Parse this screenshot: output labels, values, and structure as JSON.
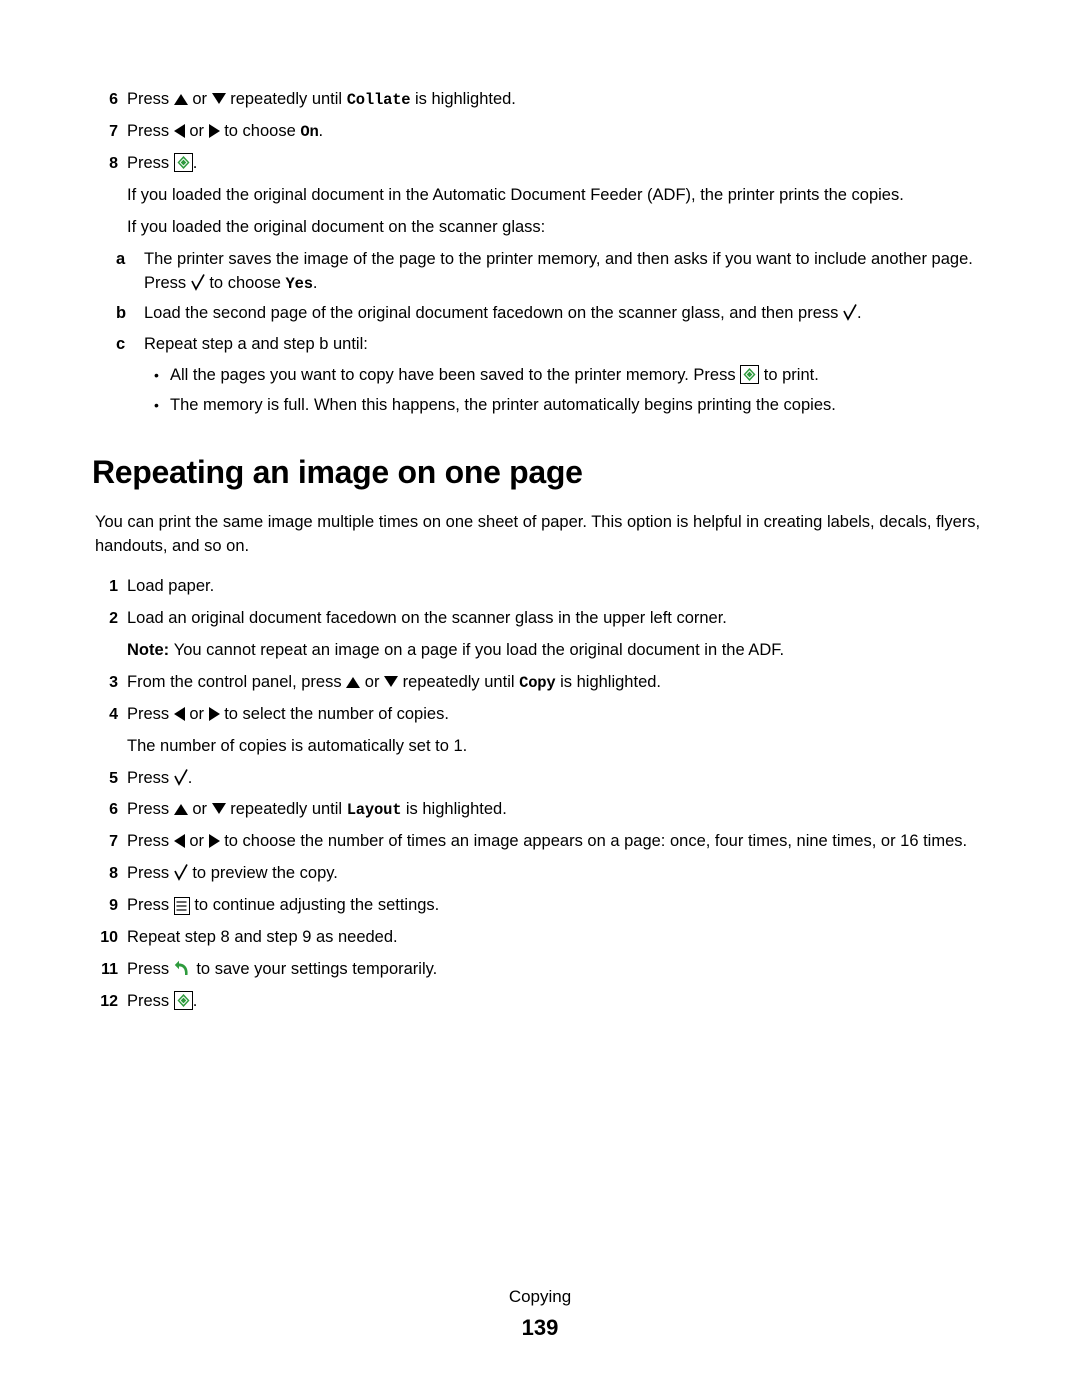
{
  "document": {
    "top_steps": [
      {
        "num": "6",
        "parts": [
          {
            "t": "text",
            "v": "Press "
          },
          {
            "t": "icon",
            "v": "arrow-up-icon"
          },
          {
            "t": "text",
            "v": " or "
          },
          {
            "t": "icon",
            "v": "arrow-down-icon"
          },
          {
            "t": "text",
            "v": " repeatedly until "
          },
          {
            "t": "mono",
            "v": "Collate"
          },
          {
            "t": "text",
            "v": " is highlighted."
          }
        ]
      },
      {
        "num": "7",
        "parts": [
          {
            "t": "text",
            "v": "Press "
          },
          {
            "t": "icon",
            "v": "arrow-left-icon"
          },
          {
            "t": "text",
            "v": " or "
          },
          {
            "t": "icon",
            "v": "arrow-right-icon"
          },
          {
            "t": "text",
            "v": " to choose "
          },
          {
            "t": "mono",
            "v": "On"
          },
          {
            "t": "text",
            "v": "."
          }
        ]
      },
      {
        "num": "8",
        "parts": [
          {
            "t": "text",
            "v": "Press "
          },
          {
            "t": "icon",
            "v": "start-button-icon"
          },
          {
            "t": "text",
            "v": "."
          }
        ]
      }
    ],
    "top_paragraphs": [
      "If you loaded the original document in the Automatic Document Feeder (ADF), the printer prints the copies.",
      "If you loaded the original document on the scanner glass:"
    ],
    "sub_steps": [
      {
        "letter": "a",
        "parts": [
          {
            "t": "text",
            "v": "The printer saves the image of the page to the printer memory, and then asks if you want to include another page. Press "
          },
          {
            "t": "icon",
            "v": "select-check-icon"
          },
          {
            "t": "text",
            "v": " to choose "
          },
          {
            "t": "mono",
            "v": "Yes"
          },
          {
            "t": "text",
            "v": "."
          }
        ]
      },
      {
        "letter": "b",
        "parts": [
          {
            "t": "text",
            "v": "Load the second page of the original document facedown on the scanner glass, and then press "
          },
          {
            "t": "icon",
            "v": "select-check-icon"
          },
          {
            "t": "text",
            "v": "."
          }
        ]
      },
      {
        "letter": "c",
        "parts": [
          {
            "t": "text",
            "v": "Repeat step a and step b until:"
          }
        ]
      }
    ],
    "bullets": [
      {
        "parts": [
          {
            "t": "text",
            "v": "All the pages you want to copy have been saved to the printer memory. Press "
          },
          {
            "t": "icon",
            "v": "start-button-icon"
          },
          {
            "t": "text",
            "v": " to print."
          }
        ]
      },
      {
        "parts": [
          {
            "t": "text",
            "v": "The memory is full. When this happens, the printer automatically begins printing the copies."
          }
        ]
      }
    ],
    "heading": "Repeating an image on one page",
    "intro": "You can print the same image multiple times on one sheet of paper. This option is helpful in creating labels, decals, flyers, handouts, and so on.",
    "main_steps": [
      {
        "num": "1",
        "parts": [
          {
            "t": "text",
            "v": "Load paper."
          }
        ]
      },
      {
        "num": "2",
        "parts": [
          {
            "t": "text",
            "v": "Load an original document facedown on the scanner glass in the upper left corner."
          }
        ]
      },
      {
        "num": "",
        "note": true,
        "parts": [
          {
            "t": "bold",
            "v": "Note: "
          },
          {
            "t": "text",
            "v": "You cannot repeat an image on a page if you load the original document in the ADF."
          }
        ]
      },
      {
        "num": "3",
        "parts": [
          {
            "t": "text",
            "v": "From the control panel, press "
          },
          {
            "t": "icon",
            "v": "arrow-up-icon"
          },
          {
            "t": "text",
            "v": " or "
          },
          {
            "t": "icon",
            "v": "arrow-down-icon"
          },
          {
            "t": "text",
            "v": " repeatedly until "
          },
          {
            "t": "mono",
            "v": "Copy"
          },
          {
            "t": "text",
            "v": " is highlighted."
          }
        ]
      },
      {
        "num": "4",
        "parts": [
          {
            "t": "text",
            "v": "Press "
          },
          {
            "t": "icon",
            "v": "arrow-left-icon"
          },
          {
            "t": "text",
            "v": " or "
          },
          {
            "t": "icon",
            "v": "arrow-right-icon"
          },
          {
            "t": "text",
            "v": " to select the number of copies."
          }
        ]
      },
      {
        "num": "",
        "plain": true,
        "parts": [
          {
            "t": "text",
            "v": "The number of copies is automatically set to 1."
          }
        ]
      },
      {
        "num": "5",
        "parts": [
          {
            "t": "text",
            "v": "Press "
          },
          {
            "t": "icon",
            "v": "select-check-icon"
          },
          {
            "t": "text",
            "v": "."
          }
        ]
      },
      {
        "num": "6",
        "parts": [
          {
            "t": "text",
            "v": "Press "
          },
          {
            "t": "icon",
            "v": "arrow-up-icon"
          },
          {
            "t": "text",
            "v": " or "
          },
          {
            "t": "icon",
            "v": "arrow-down-icon"
          },
          {
            "t": "text",
            "v": " repeatedly until "
          },
          {
            "t": "mono",
            "v": "Layout"
          },
          {
            "t": "text",
            "v": " is highlighted."
          }
        ]
      },
      {
        "num": "7",
        "parts": [
          {
            "t": "text",
            "v": "Press "
          },
          {
            "t": "icon",
            "v": "arrow-left-icon"
          },
          {
            "t": "text",
            "v": " or "
          },
          {
            "t": "icon",
            "v": "arrow-right-icon"
          },
          {
            "t": "text",
            "v": " to choose the number of times an image appears on a page: once, four times, nine times, or 16 times."
          }
        ]
      },
      {
        "num": "8",
        "parts": [
          {
            "t": "text",
            "v": "Press "
          },
          {
            "t": "icon",
            "v": "select-check-icon"
          },
          {
            "t": "text",
            "v": " to preview the copy."
          }
        ]
      },
      {
        "num": "9",
        "parts": [
          {
            "t": "text",
            "v": "Press "
          },
          {
            "t": "icon",
            "v": "menu-button-icon"
          },
          {
            "t": "text",
            "v": " to continue adjusting the settings."
          }
        ]
      },
      {
        "num": "10",
        "parts": [
          {
            "t": "text",
            "v": "Repeat step 8 and step 9 as needed."
          }
        ]
      },
      {
        "num": "11",
        "parts": [
          {
            "t": "text",
            "v": "Press "
          },
          {
            "t": "icon",
            "v": "back-button-icon"
          },
          {
            "t": "text",
            "v": " to save your settings temporarily."
          }
        ]
      },
      {
        "num": "12",
        "parts": [
          {
            "t": "text",
            "v": "Press "
          },
          {
            "t": "icon",
            "v": "start-button-icon"
          },
          {
            "t": "text",
            "v": "."
          }
        ]
      }
    ],
    "footer": {
      "section": "Copying",
      "page_number": "139"
    },
    "colors": {
      "start_icon_green": "#2e9b3d",
      "back_icon_green": "#2e9b3d",
      "text": "#000000",
      "background": "#ffffff"
    }
  }
}
